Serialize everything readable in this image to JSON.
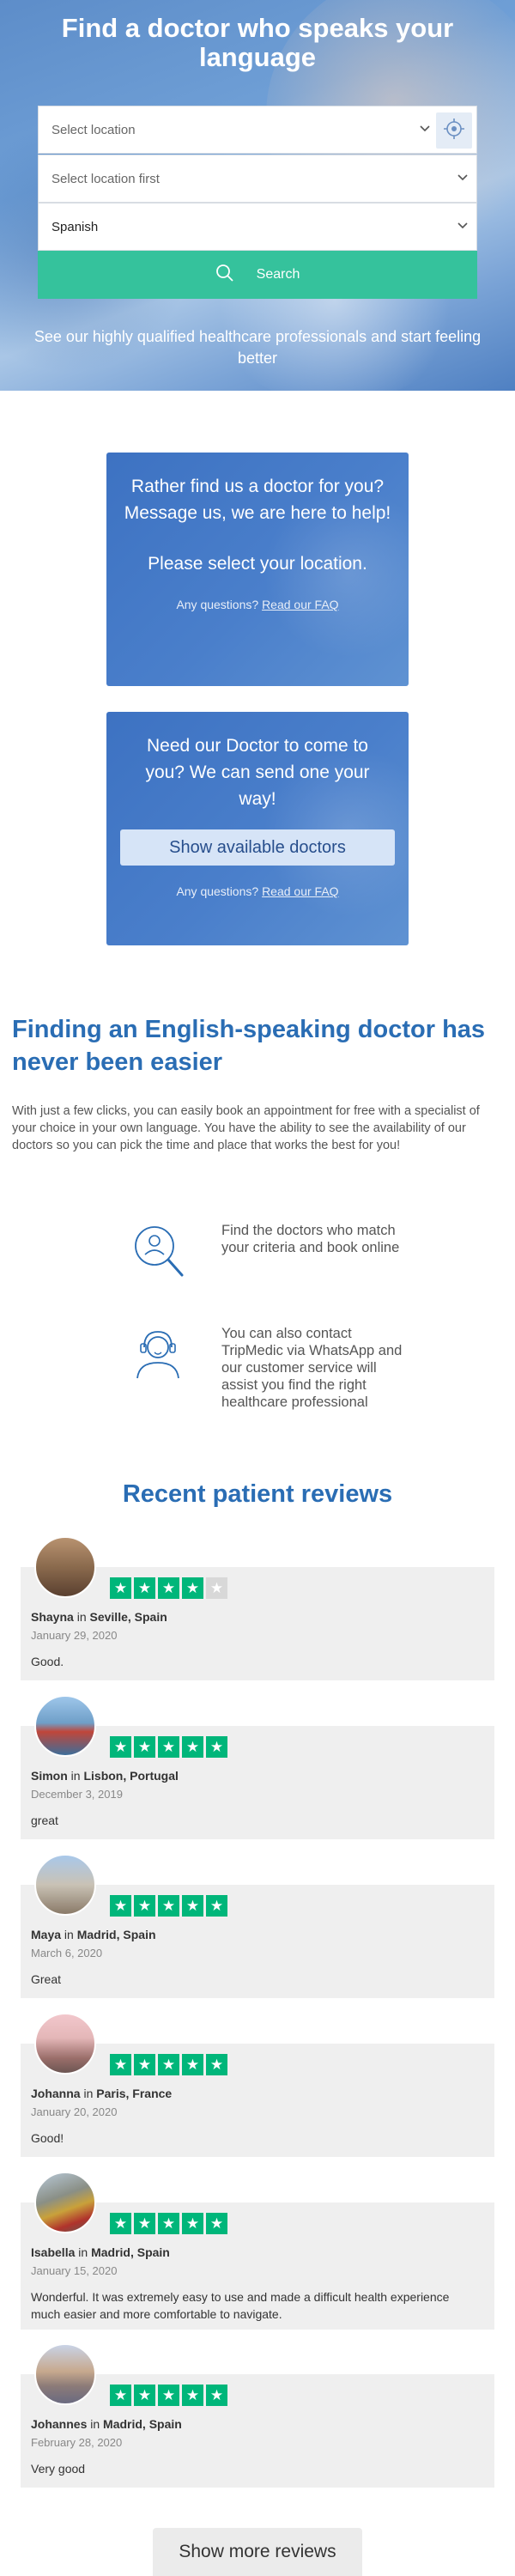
{
  "hero": {
    "title": "Find a doctor who speaks your language",
    "location_placeholder": "Select location",
    "sublocation_placeholder": "Select location first",
    "language_value": "Spanish",
    "search_label": "Search",
    "subtitle": "See our highly qualified healthcare professionals and start feeling better"
  },
  "card_message": {
    "title": "Rather find us a doctor for you? Message us, we are here to help!",
    "prompt": "Please select your location.",
    "faq_prefix": "Any questions?",
    "faq_link": "Read our FAQ"
  },
  "card_visit": {
    "title": "Need our Doctor to come to you? We can send one your way!",
    "button_label": "Show available doctors",
    "faq_prefix": "Any questions?",
    "faq_link": "Read our FAQ"
  },
  "info": {
    "title": "Finding an English-speaking doctor has never been easier",
    "body": "With just a few clicks, you can easily book an appointment for free with a specialist of your choice in your own language. You have the ability to see the availability of our doctors so you can pick the time and place that works the best for you!",
    "features": [
      {
        "icon": "search-person-icon",
        "text": "Find the doctors who match your criteria and book online"
      },
      {
        "icon": "support-agent-icon",
        "text": "You can also contact TripMedic via WhatsApp and our customer service will assist you find the right healthcare professional"
      }
    ]
  },
  "reviews": {
    "title": "Recent patient reviews",
    "items": [
      {
        "name": "Shayna",
        "in": "in",
        "location": "Seville, Spain",
        "date": "January 29, 2020",
        "text": "Good.",
        "rating": 4
      },
      {
        "name": "Simon",
        "in": "in",
        "location": "Lisbon, Portugal",
        "date": "December 3, 2019",
        "text": "great",
        "rating": 5
      },
      {
        "name": "Maya",
        "in": "in",
        "location": "Madrid, Spain",
        "date": "March 6, 2020",
        "text": "Great",
        "rating": 5
      },
      {
        "name": "Johanna",
        "in": "in",
        "location": "Paris, France",
        "date": "January 20, 2020",
        "text": "Good!",
        "rating": 5
      },
      {
        "name": "Isabella",
        "in": "in",
        "location": "Madrid, Spain",
        "date": "January 15, 2020",
        "text": "Wonderful. It was extremely easy to use and made a difficult health experience much easier and more comfortable to navigate.",
        "rating": 5
      },
      {
        "name": "Johannes",
        "in": "in",
        "location": "Madrid, Spain",
        "date": "February 28, 2020",
        "text": "Very good",
        "rating": 5
      }
    ],
    "more_label": "Show more reviews"
  },
  "colors": {
    "brand_blue": "#2a6db4",
    "search_green": "#35c29c",
    "star_green": "#00b67a",
    "card_blue": "#4a7fcb"
  }
}
